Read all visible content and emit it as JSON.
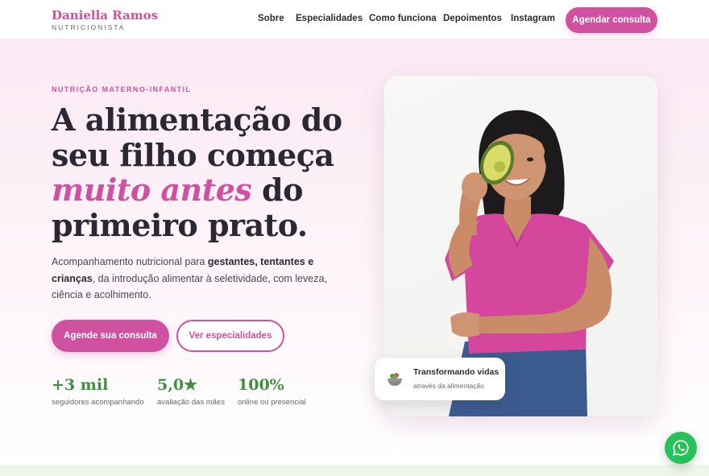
{
  "brand": {
    "name": "Daniella Ramos",
    "subtitle": "NUTRICIONISTA"
  },
  "nav": {
    "items": [
      "Sobre",
      "Especialidades",
      "Como funciona",
      "Depoimentos",
      "Instagram"
    ],
    "cta_label": "Agendar consulta"
  },
  "hero": {
    "eyebrow": "NUTRIÇÃO MATERNO-INFANTIL",
    "headline": {
      "part1": "A alimentação do seu filho começa ",
      "accent": "muito antes",
      "part2": " do primeiro prato."
    },
    "lead": {
      "part1": "Acompanhamento nutricional para ",
      "bold": "gestantes, tentantes e crianças",
      "part2": ", da introdução alimentar à seletividade, com leveza, ciência e acolhimento."
    },
    "primary_button": "Agende sua consulta",
    "secondary_button": "Ver especialidades",
    "stats": [
      {
        "value": "+3 mil",
        "label": "seguidores acompanhando"
      },
      {
        "value": "5,0★",
        "label": "avaliação das mães"
      },
      {
        "value": "100%",
        "label": "online ou presencial"
      }
    ]
  },
  "badge": {
    "title": "Transformando vidas",
    "subtitle": "através da alimentação",
    "icon": "salad-bowl-icon"
  },
  "floating": {
    "icon": "whatsapp-icon"
  },
  "colors": {
    "accent": "#d0519f",
    "green": "#3f8f3f",
    "whatsapp": "#25c25a"
  }
}
